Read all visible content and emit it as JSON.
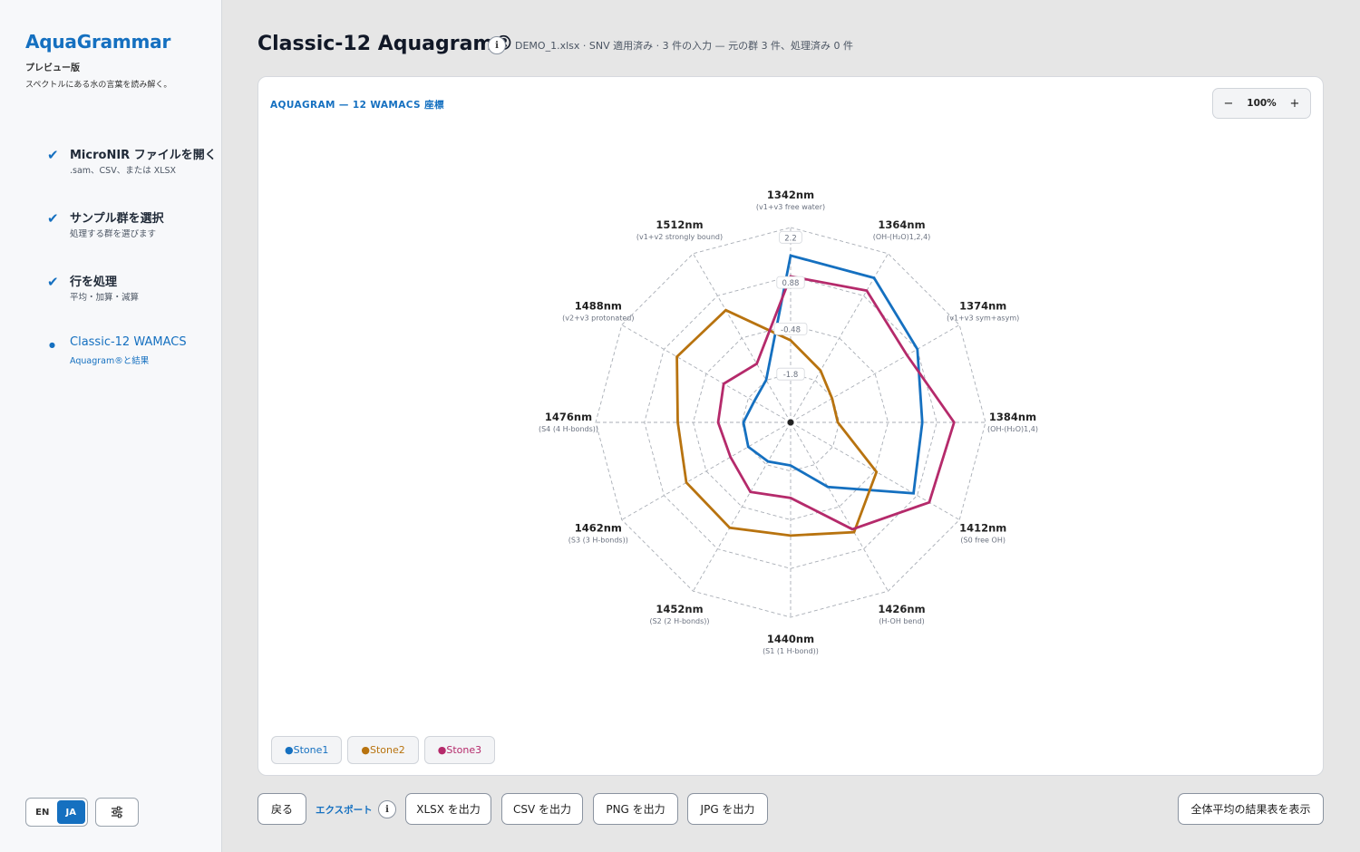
{
  "sidebar": {
    "brand": "AquaGrammar",
    "edition": "プレビュー版",
    "tagline": "スペクトルにある水の言葉を読み解く。",
    "steps": [
      {
        "title": "MicroNIR ファイルを開く",
        "sub": ".sam、CSV、または XLSX",
        "status": "done"
      },
      {
        "title": "サンプル群を選択",
        "sub": "処理する群を選びます",
        "status": "done"
      },
      {
        "title": "行を処理",
        "sub": "平均・加算・減算",
        "status": "done"
      },
      {
        "title": "Classic-12 WAMACS",
        "sub": "Aquagram®と結果",
        "status": "active"
      }
    ],
    "lang": {
      "en": "EN",
      "ja": "JA",
      "selected": "JA"
    },
    "settings_icon": "sliders-icon"
  },
  "header": {
    "title": "Classic-12 Aquagram®",
    "meta": "DEMO_1.xlsx  ·  SNV 適用済み  ·  3 件の入力 — 元の群 3 件、処理済み 0 件"
  },
  "card": {
    "label": "AQUAGRAM — 12 WAMACS 座標",
    "zoom": {
      "minus": "−",
      "value": "100%",
      "plus": "+"
    }
  },
  "chart_data": {
    "type": "radar",
    "axes": [
      {
        "label": "1342nm",
        "sub": "(v1+v3 free water)"
      },
      {
        "label": "1364nm",
        "sub": "(OH-(H₂O)1,2,4)"
      },
      {
        "label": "1374nm",
        "sub": "(v1+v3 sym+asym)"
      },
      {
        "label": "1384nm",
        "sub": "(OH-(H₂O)1,4)"
      },
      {
        "label": "1412nm",
        "sub": "(S0 free OH)"
      },
      {
        "label": "1426nm",
        "sub": "(H-OH bend)"
      },
      {
        "label": "1440nm",
        "sub": "(S1 (1 H-bond))"
      },
      {
        "label": "1452nm",
        "sub": "(S2 (2 H-bonds))"
      },
      {
        "label": "1462nm",
        "sub": "(S3 (3 H-bonds))"
      },
      {
        "label": "1476nm",
        "sub": "(S4 (4 H-bonds))"
      },
      {
        "label": "1488nm",
        "sub": "(v2+v3 protonated)"
      },
      {
        "label": "1512nm",
        "sub": "(v1+v2 strongly bound)"
      }
    ],
    "rlim": [
      -3.2,
      2.5
    ],
    "ticks": [
      "2.2",
      "0.88",
      "-0.48",
      "-1.8"
    ],
    "tick_values": [
      2.2,
      0.88,
      -0.48,
      -1.8
    ],
    "series": [
      {
        "name": "Stone1",
        "color": "#1570c0",
        "values": [
          1.68,
          1.68,
          1.08,
          0.65,
          0.95,
          -1.02,
          -1.94,
          -1.88,
          -1.77,
          -1.82,
          -1.97,
          -1.77
        ]
      },
      {
        "name": "Stone2",
        "color": "#b8730f",
        "values": [
          -0.8,
          -1.45,
          -1.8,
          -1.82,
          -0.3,
          0.51,
          0.11,
          0.36,
          0.32,
          0.1,
          0.64,
          0.59
        ]
      },
      {
        "name": "Stone3",
        "color": "#b52a6b",
        "values": [
          1.07,
          1.25,
          0.73,
          1.58,
          1.48,
          0.41,
          -0.99,
          -0.85,
          -1.17,
          -1.08,
          -0.94,
          -1.22
        ]
      }
    ]
  },
  "legend": [
    "Stone1",
    "Stone2",
    "Stone3"
  ],
  "toolbar": {
    "back": "戻る",
    "export_label": "エクスポート",
    "xlsx": "XLSX を出力",
    "csv": "CSV を出力",
    "png": "PNG を出力",
    "jpg": "JPG を出力",
    "summary": "全体平均の結果表を表示"
  }
}
